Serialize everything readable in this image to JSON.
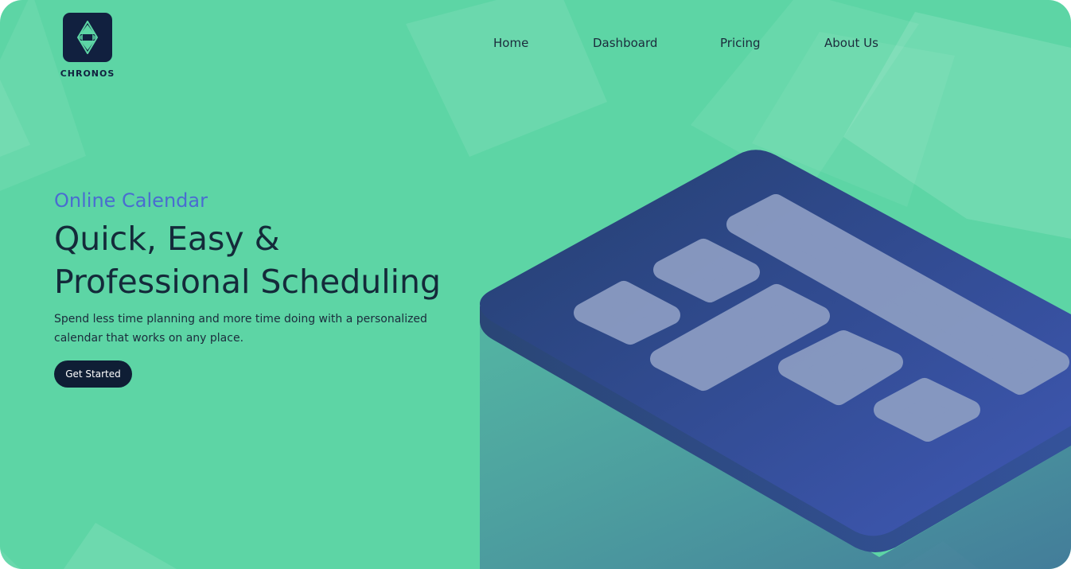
{
  "brand": {
    "name": "CHRONOS",
    "logo_icon": "diamond-crystal-icon"
  },
  "nav": {
    "items": [
      {
        "label": "Home"
      },
      {
        "label": "Dashboard"
      },
      {
        "label": "Pricing"
      },
      {
        "label": "About Us"
      }
    ]
  },
  "hero": {
    "eyebrow": "Online Calendar",
    "headline_line1": "Quick, Easy &",
    "headline_line2": "Professional Scheduling",
    "subtext": "Spend less time planning and more time doing with a personalized calendar that works on any place.",
    "cta_label": "Get Started"
  },
  "illustration": {
    "icon": "isometric-calendar-illustration"
  },
  "colors": {
    "background": "#5dd5a5",
    "dark_navy": "#11203f",
    "accent_blue": "#4a6cd1",
    "calendar_top": "#2c4b86",
    "calendar_tiles": "#8a9bc2"
  }
}
